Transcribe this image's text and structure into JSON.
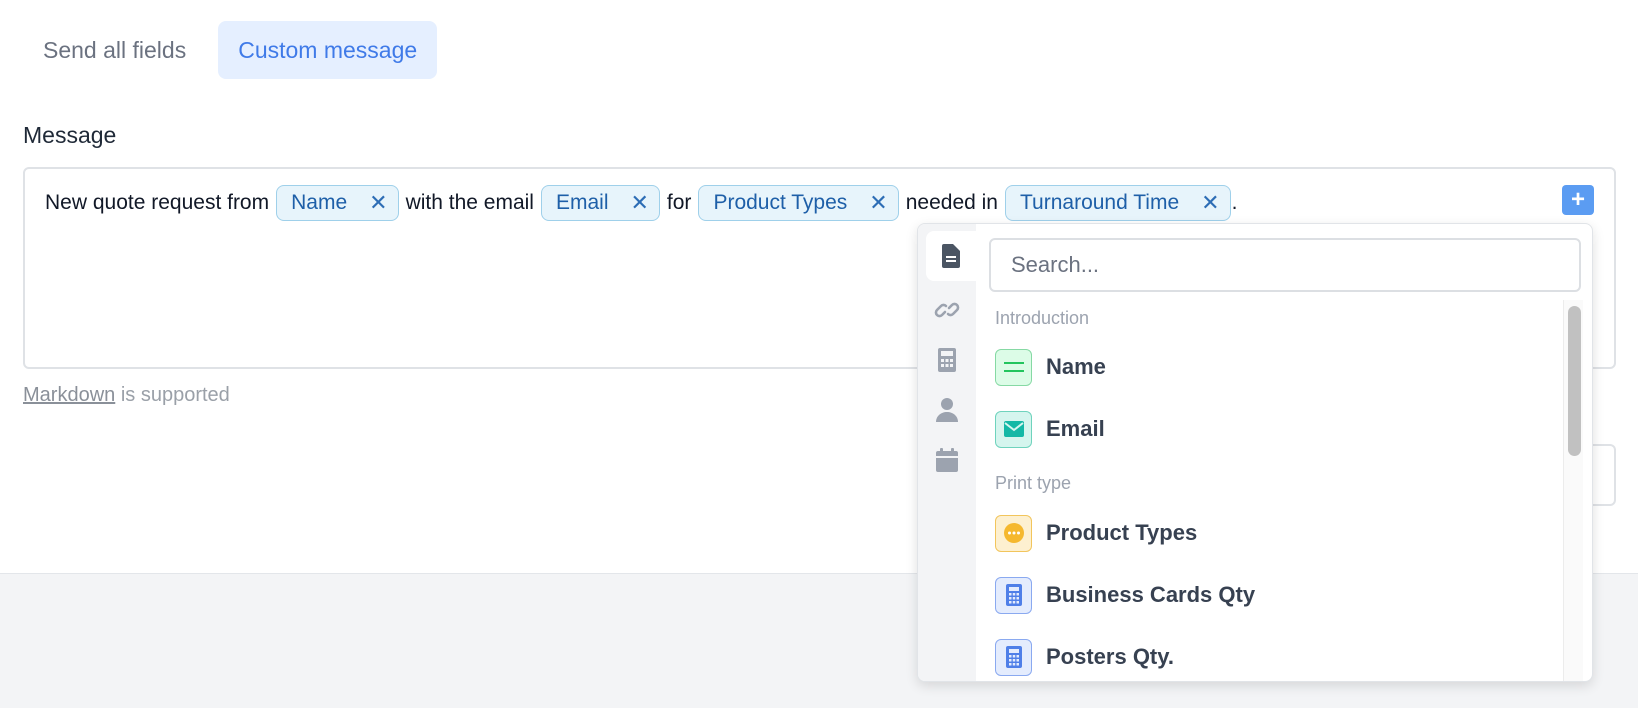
{
  "tabs": [
    {
      "label": "Send all fields",
      "active": false
    },
    {
      "label": "Custom message",
      "active": true
    }
  ],
  "message": {
    "label": "Message",
    "segments": {
      "t1": "New quote request from",
      "chip1": "Name",
      "t2": "with the email",
      "chip2": "Email",
      "t3": "for",
      "chip3": "Product Types",
      "t4": "needed in",
      "chip4": "Turnaround Time",
      "t5": "."
    },
    "chip_remove_glyph": "✕",
    "add_button": "+",
    "markdown_link": "Markdown",
    "markdown_suffix": " is supported"
  },
  "dropdown": {
    "search_placeholder": "Search...",
    "sidebar_icons": [
      "document-icon",
      "link-icon",
      "calculator-icon",
      "person-icon",
      "calendar-icon"
    ],
    "groups": [
      {
        "label": "Introduction",
        "items": [
          {
            "label": "Name",
            "icon": "short-text-icon",
            "color": "#86d9a4"
          },
          {
            "label": "Email",
            "icon": "envelope-icon",
            "color": "#6fd3bd"
          }
        ]
      },
      {
        "label": "Print type",
        "items": [
          {
            "label": "Product Types",
            "icon": "multiple-choice-icon",
            "color": "#f2c55c"
          },
          {
            "label": "Business Cards Qty",
            "icon": "calculator-icon",
            "color": "#8aa9f0"
          },
          {
            "label": "Posters Qty.",
            "icon": "calculator-icon",
            "color": "#8aa9f0"
          }
        ]
      }
    ]
  },
  "colors": {
    "accent": "#3f7ae8",
    "active_tab_bg": "#e5efff",
    "chip_bg": "#e7f4fb",
    "chip_border": "#9fd0ea",
    "plus_button": "#5b9cf2"
  }
}
